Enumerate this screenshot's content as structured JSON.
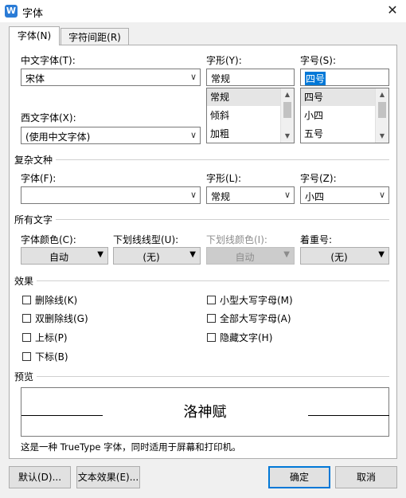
{
  "window": {
    "title": "字体",
    "app_icon_letter": "W"
  },
  "tabs": [
    {
      "label": "字体(N)"
    },
    {
      "label": "字符间距(R)"
    }
  ],
  "chinese_font": {
    "label": "中文字体(T):",
    "value": "宋体"
  },
  "western_font": {
    "label": "西文字体(X):",
    "value": "(使用中文字体)"
  },
  "style": {
    "label": "字形(Y):",
    "value": "常规",
    "options": [
      "常规",
      "倾斜",
      "加粗"
    ]
  },
  "size": {
    "label": "字号(S):",
    "value": "四号",
    "options": [
      "四号",
      "小四",
      "五号"
    ]
  },
  "complex": {
    "section_title": "复杂文种",
    "font_label": "字体(F):",
    "font_value": "",
    "style_label": "字形(L):",
    "style_value": "常规",
    "size_label": "字号(Z):",
    "size_value": "小四"
  },
  "all_text": {
    "section_title": "所有文字",
    "color_label": "字体颜色(C):",
    "color_value": "自动",
    "underline_label": "下划线线型(U):",
    "underline_value": "(无)",
    "underline_color_label": "下划线颜色(I):",
    "underline_color_value": "自动",
    "emphasis_label": "着重号:",
    "emphasis_value": "(无)"
  },
  "effects": {
    "section_title": "效果",
    "left": [
      "删除线(K)",
      "双删除线(G)",
      "上标(P)",
      "下标(B)"
    ],
    "right": [
      "小型大写字母(M)",
      "全部大写字母(A)",
      "隐藏文字(H)"
    ]
  },
  "preview": {
    "section_title": "预览",
    "sample": "洛神赋",
    "note": "这是一种 TrueType 字体，同时适用于屏幕和打印机。"
  },
  "buttons": {
    "default": "默认(D)...",
    "text_effect": "文本效果(E)...",
    "ok": "确定",
    "cancel": "取消"
  },
  "icons": {
    "close": "close-icon",
    "dropdown": "chevron-down-icon"
  }
}
